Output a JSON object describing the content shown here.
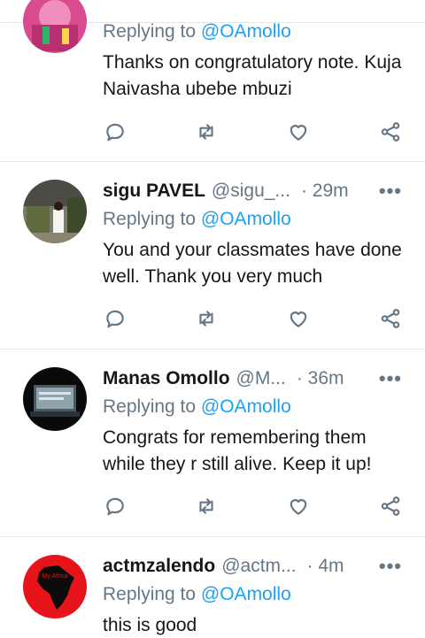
{
  "tweets": [
    {
      "name": "",
      "handle": "",
      "time": "",
      "reply_prefix": "Replying to",
      "reply_mention": "@OAmollo",
      "text": "Thanks on congratulatory note. Kuja Naivasha ubebe mbuzi"
    },
    {
      "name": "sigu PAVEL",
      "handle": "@sigu_...",
      "time": "· 29m",
      "reply_prefix": "Replying to",
      "reply_mention": "@OAmollo",
      "text": "You and your classmates have done well. Thank you very much"
    },
    {
      "name": "Manas Omollo",
      "handle": "@M...",
      "time": "· 36m",
      "reply_prefix": "Replying to",
      "reply_mention": "@OAmollo",
      "text": "Congrats for remembering them while they r still alive. Keep it up!"
    },
    {
      "name": "actmzalendo",
      "handle": "@actm...",
      "time": "· 4m",
      "reply_prefix": "Replying to",
      "reply_mention": "@OAmollo",
      "text": "this is good"
    }
  ],
  "more_glyph": "•••",
  "avatar_badge": "My Africa",
  "icons": {
    "reply": "reply-icon",
    "retweet": "retweet-icon",
    "like": "like-icon",
    "share": "share-icon",
    "more": "more-icon"
  },
  "colors": {
    "text": "#14171a",
    "muted": "#657786",
    "mention": "#1da1f2",
    "divider": "#e6ecf0"
  }
}
